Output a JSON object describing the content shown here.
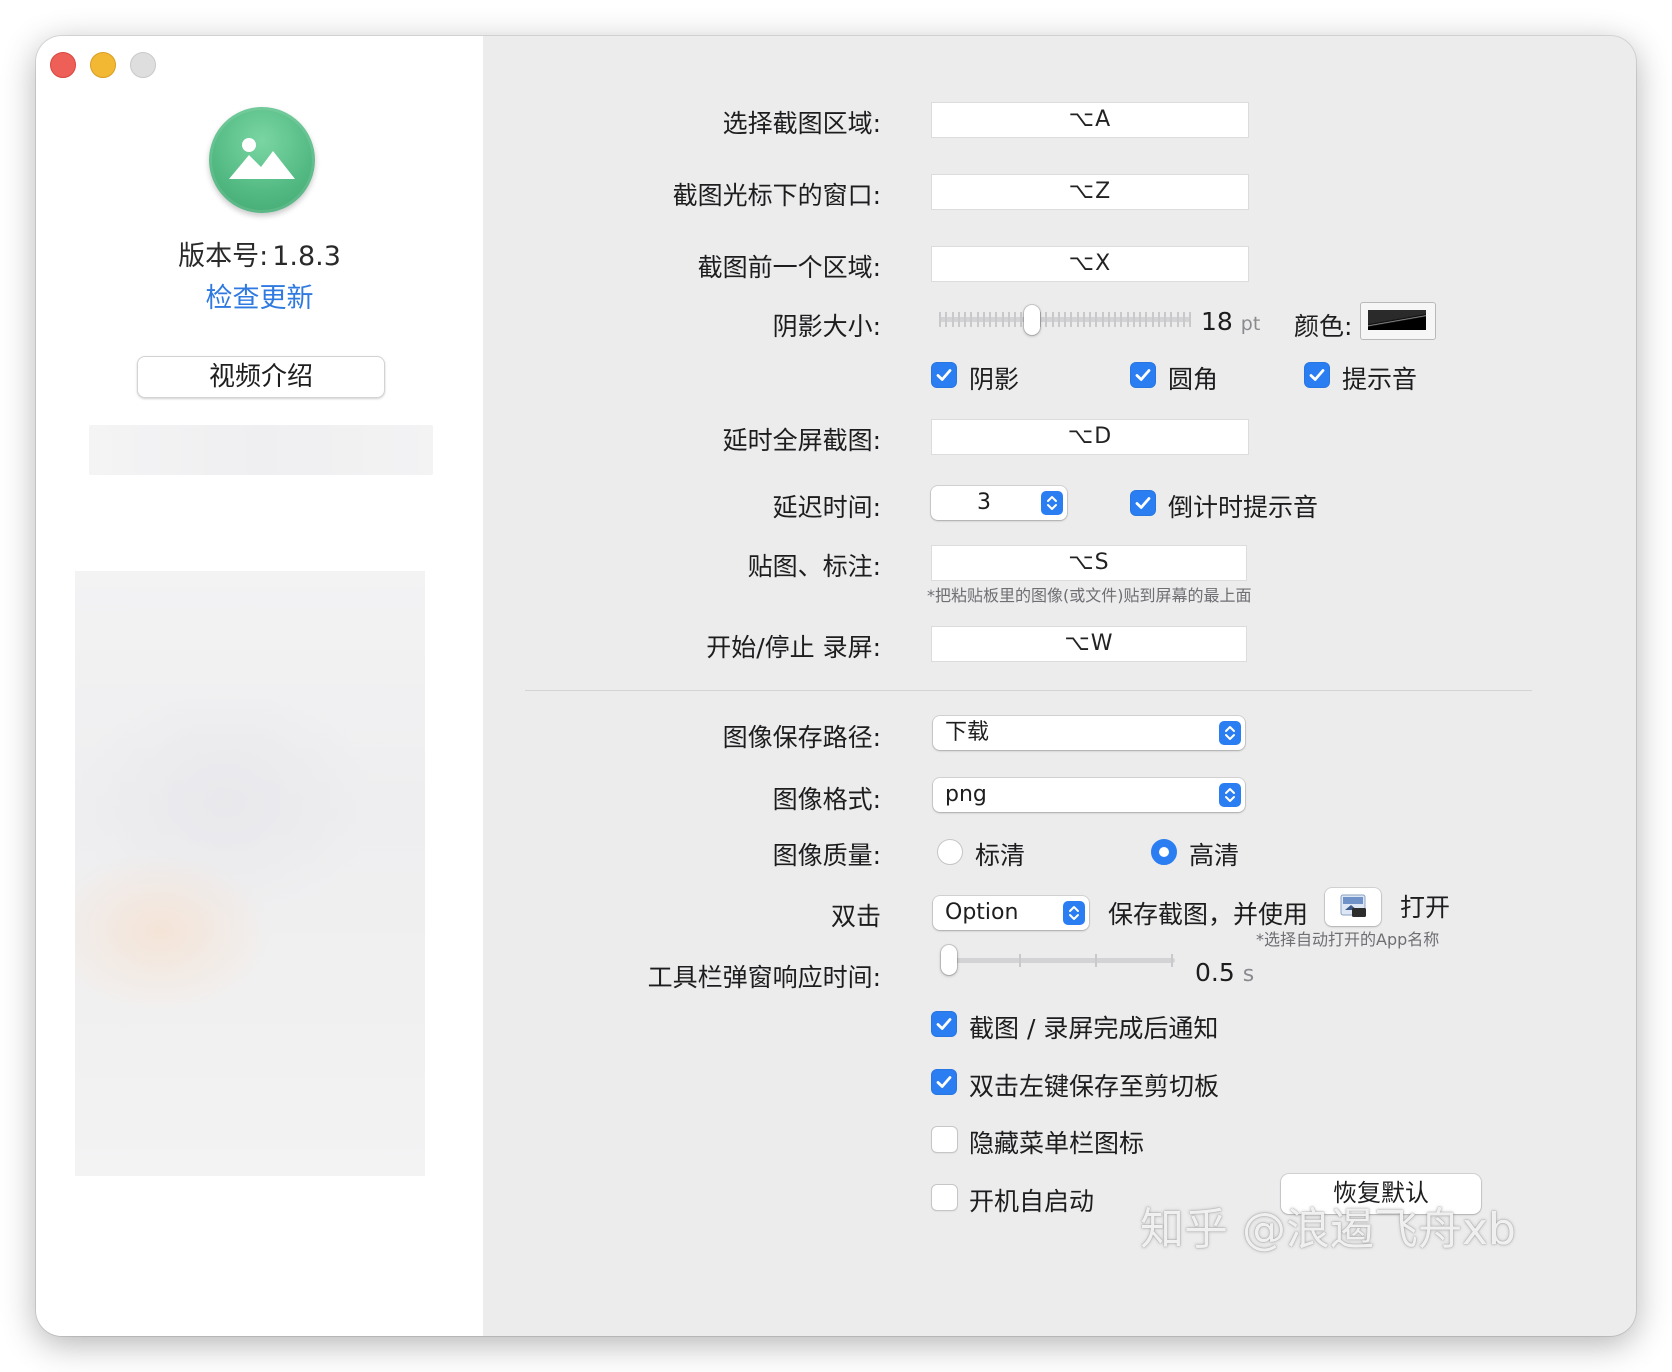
{
  "sidebar": {
    "version_label": "版本号:",
    "version_value": "1.8.3",
    "check_update": "检查更新",
    "video_button": "视频介绍"
  },
  "shortcuts": [
    {
      "label": "选择截图区域:",
      "key": "⌥A"
    },
    {
      "label": "截图光标下的窗口:",
      "key": "⌥Z"
    },
    {
      "label": "截图前一个区域:",
      "key": "⌥X"
    }
  ],
  "shadow": {
    "label": "阴影大小:",
    "value": "18",
    "unit": "pt",
    "level": 0.36,
    "color_label": "颜色:"
  },
  "options_row": [
    {
      "label": "阴影",
      "checked": true
    },
    {
      "label": "圆角",
      "checked": true
    },
    {
      "label": "提示音",
      "checked": true
    }
  ],
  "delayed_fullscreen": {
    "label": "延时全屏截图:",
    "key": "⌥D"
  },
  "delay_time": {
    "label": "延迟时间:",
    "value": "3",
    "countdown_label": "倒计时提示音",
    "countdown_checked": true
  },
  "pin_annotate": {
    "label": "贴图、标注:",
    "key": "⌥S",
    "hint": "*把粘贴板里的图像(或文件)贴到屏幕的最上面"
  },
  "record": {
    "label": "开始/停止 录屏:",
    "key": "⌥W"
  },
  "save_path": {
    "label": "图像保存路径:",
    "value": "下载"
  },
  "image_format": {
    "label": "图像格式:",
    "value": "png"
  },
  "image_quality": {
    "label": "图像质量:",
    "options": [
      {
        "label": "标清",
        "selected": false
      },
      {
        "label": "高清",
        "selected": true
      }
    ]
  },
  "double_click": {
    "label": "双击",
    "modifier": "Option",
    "middle_text": "保存截图，并使用",
    "open_text": "打开",
    "hint": "*选择自动打开的App名称"
  },
  "toolbar_delay": {
    "label": "工具栏弹窗响应时间:",
    "value": "0.5",
    "unit": "s",
    "level": 0.0
  },
  "bottom_checks": [
    {
      "label": "截图 / 录屏完成后通知",
      "checked": true
    },
    {
      "label": "双击左键保存至剪切板",
      "checked": true
    },
    {
      "label": "隐藏菜单栏图标",
      "checked": false
    },
    {
      "label": "开机自启动",
      "checked": false
    }
  ],
  "restore_defaults": "恢复默认",
  "watermark": "知乎 @浪遏飞舟xb",
  "colors": {
    "accent": "#2a7ef1",
    "link": "#2f7ae0",
    "window_bg": "#ececed",
    "icon_green": "#55bb85"
  }
}
